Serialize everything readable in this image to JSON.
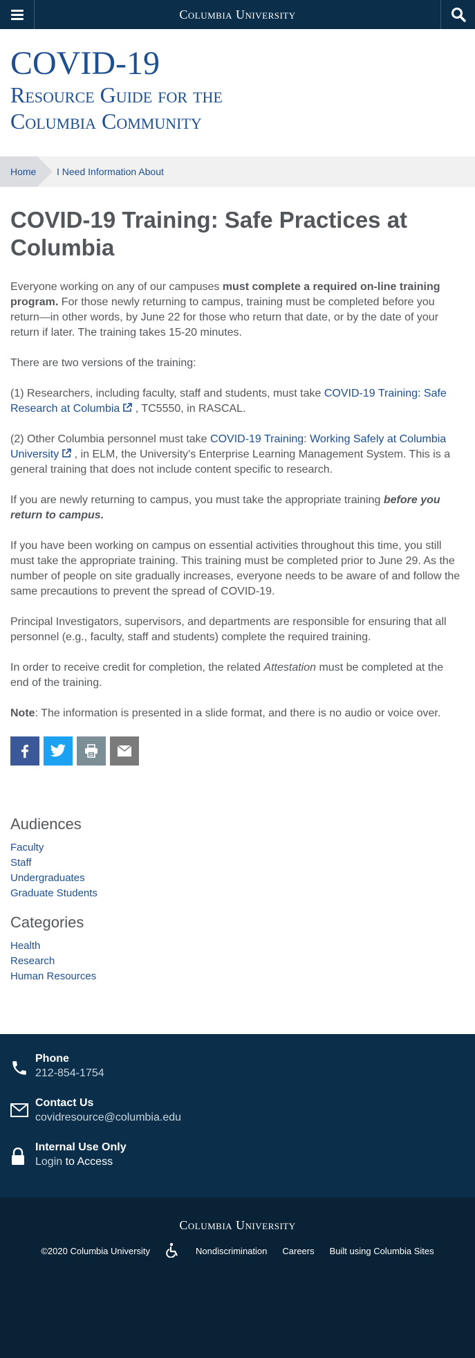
{
  "header": {
    "brand": "Columbia University"
  },
  "site_title": {
    "line1": "COVID-19",
    "line2": "Resource Guide for the",
    "line3": "Columbia Community"
  },
  "breadcrumb": {
    "home": "Home",
    "current": "I Need Information About"
  },
  "article": {
    "title": "COVID-19 Training: Safe Practices at Columbia",
    "p1_a": "Everyone working on any of our campuses ",
    "p1_bold": "must complete a required on-line training program.",
    "p1_b": " For those newly returning to campus, training must be completed before you return—in other words, by June 22 for those who return that date, or by the date of your return if later. The training takes 15-20 minutes.",
    "p2": "There are two versions of the training:",
    "p3_a": "(1) Researchers, including faculty, staff and students, must take ",
    "p3_link": "COVID-19 Training: Safe Research at Columbia",
    "p3_b": " , TC5550, in RASCAL.",
    "p4_a": "(2) Other Columbia personnel must take ",
    "p4_link": "COVID-19 Training: Working Safely at Columbia University",
    "p4_b": " , in ELM, the University's Enterprise Learning Management System. This is a general training that does not include content specific to research.",
    "p5_a": "If you are newly returning to campus, you must take the appropriate training ",
    "p5_emph": "before you return to campus.",
    "p6": "If you have been working on campus on essential activities throughout this time, you still must take the appropriate training. This training must be completed prior to June 29. As the number of people on site gradually increases, everyone needs to be aware of and follow the same precautions to prevent the spread of COVID-19.",
    "p7": "Principal Investigators, supervisors, and departments are responsible for ensuring that all personnel (e.g., faculty, staff and students) complete the required training.",
    "p8_a": "In order to receive credit for completion, the related ",
    "p8_em": "Attestation",
    "p8_b": " must be completed at the end of the training.",
    "p9_label": "Note",
    "p9_text": ": The information is presented in a slide format, and there is no audio or voice over."
  },
  "share": {
    "facebook": "facebook-icon",
    "twitter": "twitter-icon",
    "print": "print-icon",
    "email": "email-icon"
  },
  "audiences": {
    "heading": "Audiences",
    "items": [
      "Faculty",
      "Staff",
      "Undergraduates",
      "Graduate Students"
    ]
  },
  "categories": {
    "heading": "Categories",
    "items": [
      "Health",
      "Research",
      "Human Resources"
    ]
  },
  "contact": {
    "phone_label": "Phone",
    "phone_value": "212-854-1754",
    "contact_label": "Contact Us",
    "contact_value": "covidresource@columbia.edu",
    "internal_label": "Internal Use Only",
    "internal_link": "Login",
    "internal_rest": " to Access"
  },
  "footer": {
    "brand": "Columbia University",
    "copyright": "©2020 Columbia University",
    "nondiscrimination": "Nondiscrimination",
    "careers": "Careers",
    "built": "Built using Columbia Sites"
  },
  "colors": {
    "navy": "#0b2f4a",
    "link": "#1d4f91",
    "text": "#53565a"
  }
}
